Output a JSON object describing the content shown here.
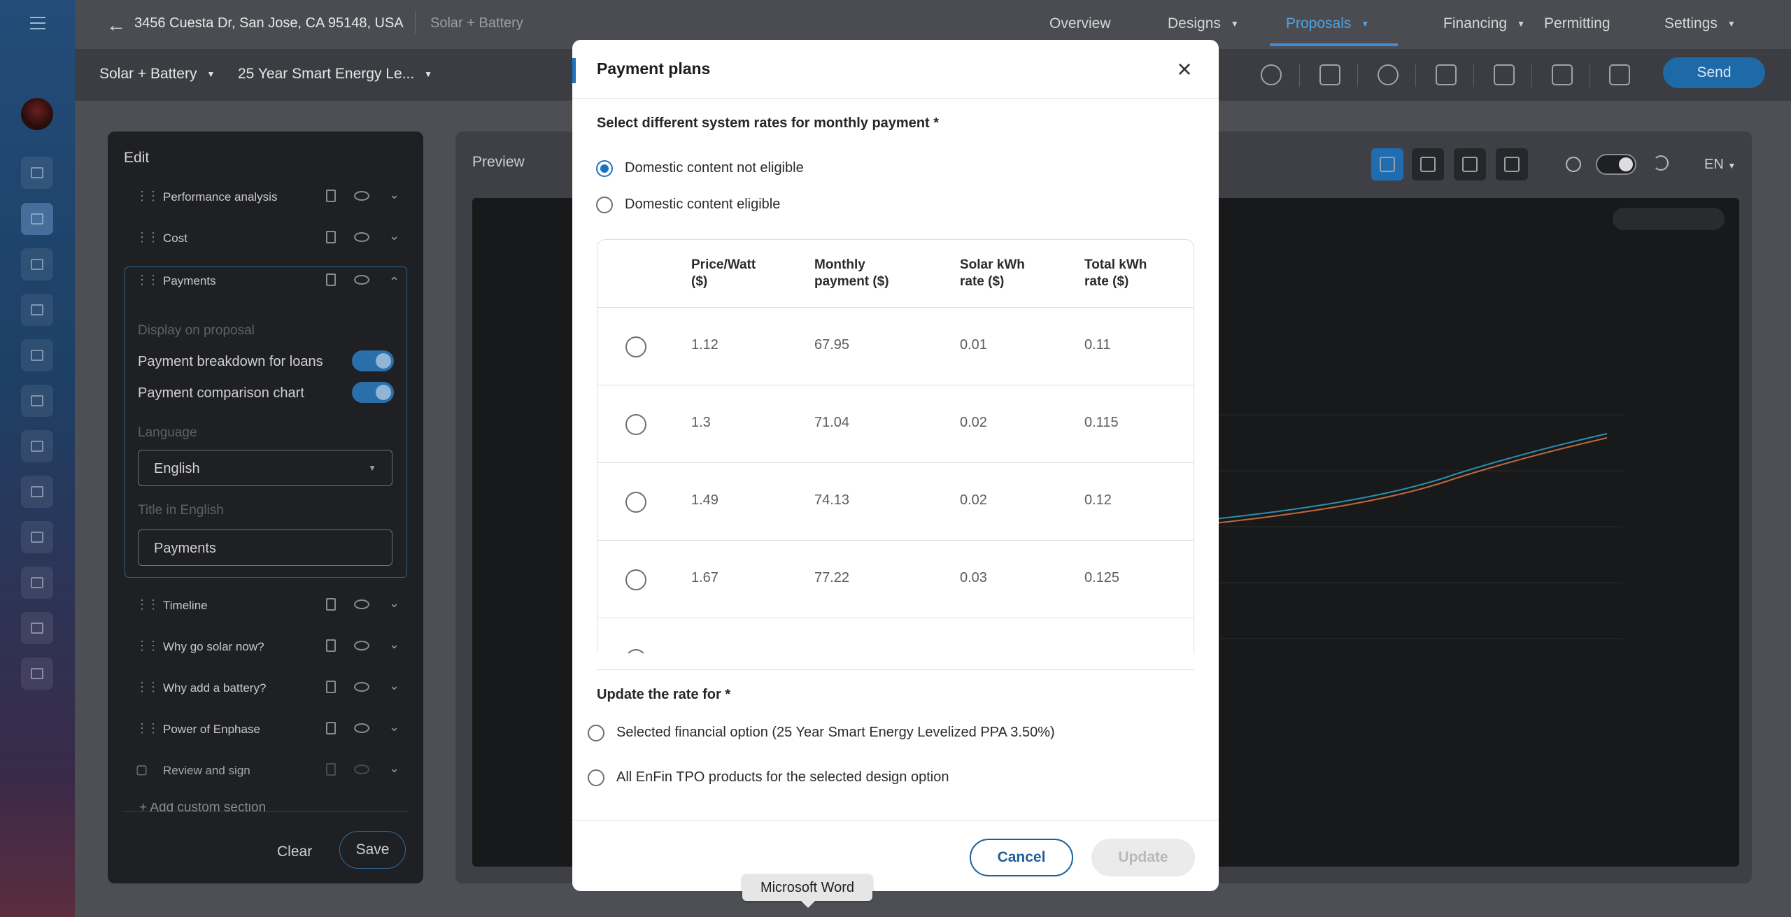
{
  "topbar": {
    "address": "3456 Cuesta Dr, San Jose, CA 95148, USA",
    "project_type": "Solar + Battery",
    "tabs": [
      {
        "label": "Overview",
        "has_caret": false
      },
      {
        "label": "Designs",
        "has_caret": true
      },
      {
        "label": "Proposals",
        "has_caret": true,
        "active": true
      },
      {
        "label": "Financing",
        "has_caret": true
      },
      {
        "label": "Permitting",
        "has_caret": false
      },
      {
        "label": "Settings",
        "has_caret": true
      }
    ]
  },
  "subbar": {
    "design_option": "Solar + Battery",
    "finance_option": "25 Year Smart Energy Le...",
    "send_label": "Send"
  },
  "edit_panel": {
    "title": "Edit",
    "sections_top": [
      "Performance analysis",
      "Cost",
      "Payments"
    ],
    "display_on_proposal": "Display on proposal",
    "toggle_breakdown": "Payment breakdown for loans",
    "toggle_comparison": "Payment comparison chart",
    "language_label": "Language",
    "language_value": "English",
    "title_label": "Title in English",
    "title_value": "Payments",
    "sections_bottom": [
      "Timeline",
      "Why go solar now?",
      "Why add a battery?",
      "Power of Enphase",
      "Review and sign"
    ],
    "add_custom": "Add custom section",
    "clear_label": "Clear",
    "save_label": "Save"
  },
  "preview": {
    "title": "Preview",
    "lang": "EN"
  },
  "modal": {
    "title": "Payment plans",
    "rates_question": "Select different system rates for monthly payment *",
    "domestic_options": [
      {
        "label": "Domestic content not eligible",
        "selected": true
      },
      {
        "label": "Domestic content eligible",
        "selected": false
      }
    ],
    "columns": [
      "Price/Watt ($)",
      "Monthly payment ($)",
      "Solar kWh rate ($)",
      "Total kWh rate ($)"
    ],
    "rows": [
      {
        "price_watt": "1.12",
        "monthly": "67.95",
        "solar_rate": "0.01",
        "total_rate": "0.11"
      },
      {
        "price_watt": "1.3",
        "monthly": "71.04",
        "solar_rate": "0.02",
        "total_rate": "0.115"
      },
      {
        "price_watt": "1.49",
        "monthly": "74.13",
        "solar_rate": "0.02",
        "total_rate": "0.12"
      },
      {
        "price_watt": "1.67",
        "monthly": "77.22",
        "solar_rate": "0.03",
        "total_rate": "0.125"
      }
    ],
    "update_question": "Update the rate for *",
    "update_options": [
      "Selected financial option (25 Year Smart Energy Levelized PPA 3.50%)",
      "All EnFin TPO products for the selected design option"
    ],
    "cancel_label": "Cancel",
    "update_label": "Update"
  },
  "tooltip": "Microsoft Word",
  "colors": {
    "accent": "#1e73be",
    "nav_active": "#4da3e8",
    "send_bg": "#1e6aa8"
  }
}
